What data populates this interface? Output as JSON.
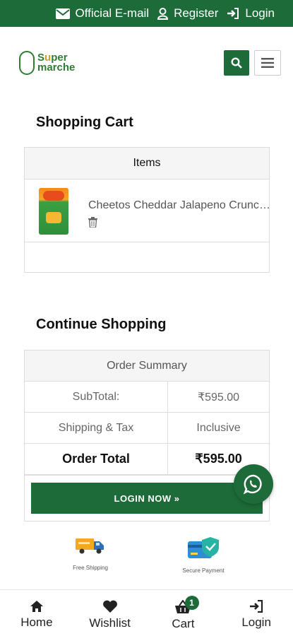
{
  "topbar": {
    "email_label": "Official E-mail",
    "register_label": "Register",
    "login_label": "Login"
  },
  "brand": {
    "logo_line1_a": "S",
    "logo_line1_o": "u",
    "logo_line1_b": "per",
    "logo_line2": "marche",
    "primary_color": "#1e6b3a"
  },
  "cart": {
    "title": "Shopping Cart",
    "items_header": "Items",
    "items": [
      {
        "name": "Cheetos Cheddar Jalapeno Crunchy"
      }
    ]
  },
  "continue": {
    "title": "Continue Shopping"
  },
  "summary": {
    "title": "Order Summary",
    "subtotal_label": "SubTotal:",
    "subtotal_value": "₹595.00",
    "shipping_label": "Shipping & Tax",
    "shipping_value": "Inclusive",
    "total_label": "Order Total",
    "total_value": "₹595.00",
    "login_button": "LOGIN NOW »"
  },
  "features": [
    {
      "caption": "Free Shipping",
      "icon": "truck-icon"
    },
    {
      "caption": "Secure Payment",
      "icon": "card-shield-icon"
    }
  ],
  "bottom_nav": {
    "home": "Home",
    "wishlist": "Wishlist",
    "cart": "Cart",
    "cart_count": "1",
    "login": "Login"
  }
}
